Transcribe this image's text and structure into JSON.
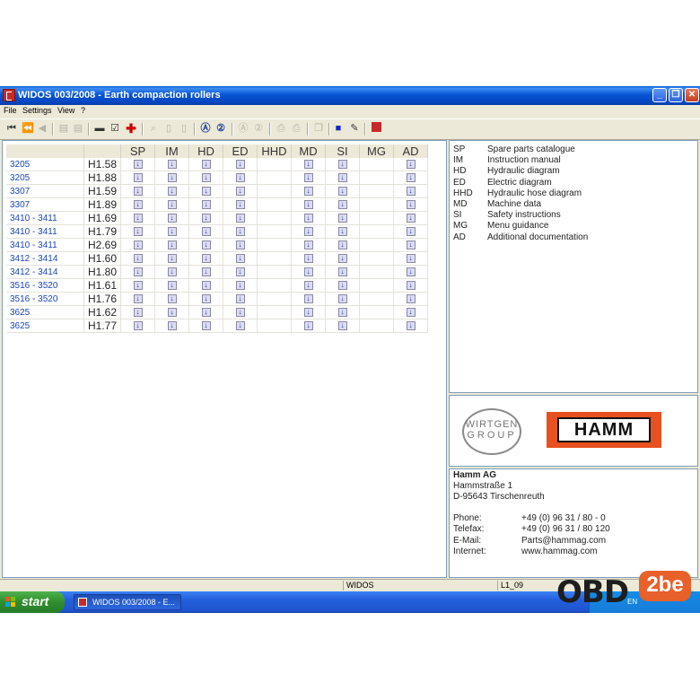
{
  "window": {
    "title": "WIDOS 003/2008 - Earth compaction rollers"
  },
  "menu": [
    "File",
    "Settings",
    "View",
    "?"
  ],
  "table": {
    "headers": [
      "SP",
      "IM",
      "HD",
      "ED",
      "HHD",
      "MD",
      "SI",
      "MG",
      "AD"
    ],
    "rows": [
      {
        "model": "3205",
        "version": "H1.58",
        "docs": [
          1,
          1,
          1,
          1,
          0,
          1,
          1,
          0,
          1
        ]
      },
      {
        "model": "3205",
        "version": "H1.88",
        "docs": [
          1,
          1,
          1,
          1,
          0,
          1,
          1,
          0,
          1
        ]
      },
      {
        "model": "3307",
        "version": "H1.59",
        "docs": [
          1,
          1,
          1,
          1,
          0,
          1,
          1,
          0,
          1
        ]
      },
      {
        "model": "3307",
        "version": "H1.89",
        "docs": [
          1,
          1,
          1,
          1,
          0,
          1,
          1,
          0,
          1
        ]
      },
      {
        "model": "3410 - 3411",
        "version": "H1.69",
        "docs": [
          1,
          1,
          1,
          1,
          0,
          1,
          1,
          0,
          1
        ]
      },
      {
        "model": "3410 - 3411",
        "version": "H1.79",
        "docs": [
          1,
          1,
          1,
          1,
          0,
          1,
          1,
          0,
          1
        ]
      },
      {
        "model": "3410 - 3411",
        "version": "H2.69",
        "docs": [
          1,
          1,
          1,
          1,
          0,
          1,
          1,
          0,
          1
        ]
      },
      {
        "model": "3412 - 3414",
        "version": "H1.60",
        "docs": [
          1,
          1,
          1,
          1,
          0,
          1,
          1,
          0,
          1
        ]
      },
      {
        "model": "3412 - 3414",
        "version": "H1.80",
        "docs": [
          1,
          1,
          1,
          1,
          0,
          1,
          1,
          0,
          1
        ]
      },
      {
        "model": "3516 - 3520",
        "version": "H1.61",
        "docs": [
          1,
          1,
          1,
          1,
          0,
          1,
          1,
          0,
          1
        ]
      },
      {
        "model": "3516 - 3520",
        "version": "H1.76",
        "docs": [
          1,
          1,
          1,
          1,
          0,
          1,
          1,
          0,
          1
        ]
      },
      {
        "model": "3625",
        "version": "H1.62",
        "docs": [
          1,
          1,
          1,
          1,
          0,
          1,
          1,
          0,
          1
        ]
      },
      {
        "model": "3625",
        "version": "H1.77",
        "docs": [
          1,
          1,
          1,
          1,
          0,
          1,
          1,
          0,
          1
        ]
      }
    ]
  },
  "legend": [
    {
      "abbr": "SP",
      "text": "Spare parts catalogue"
    },
    {
      "abbr": "IM",
      "text": "Instruction manual"
    },
    {
      "abbr": "HD",
      "text": "Hydraulic diagram"
    },
    {
      "abbr": "ED",
      "text": "Electric diagram"
    },
    {
      "abbr": "HHD",
      "text": "Hydraulic hose diagram"
    },
    {
      "abbr": "MD",
      "text": "Machine data"
    },
    {
      "abbr": "SI",
      "text": "Safety instructions"
    },
    {
      "abbr": "MG",
      "text": "Menu guidance"
    },
    {
      "abbr": "AD",
      "text": "Additional documentation"
    }
  ],
  "logos": {
    "wirtgen_line1": "WIRTGEN",
    "wirtgen_line2": "GROUP",
    "hamm": "HAMM"
  },
  "contact": {
    "company": "Hamm AG",
    "street": "Hammstraße 1",
    "city": "D-95643 Tirschenreuth",
    "phone_label": "Phone:",
    "phone": "+49 (0) 96 31 / 80 - 0",
    "fax_label": "Telefax:",
    "fax": "+49 (0) 96 31 / 80 120",
    "email_label": "E-Mail:",
    "email": "Parts@hammag.com",
    "internet_label": "Internet:",
    "internet": "www.hammag.com"
  },
  "status": {
    "app": "WIDOS",
    "code": "L1_09"
  },
  "taskbar": {
    "start": "start",
    "task": "WIDOS 003/2008 - E...",
    "tray": "EN"
  },
  "watermark": {
    "left": "OBD",
    "right": "2be"
  },
  "colors": {
    "titlebar": "#0754d4",
    "link": "#1a44c2",
    "hamm_orange": "#e8501f"
  }
}
